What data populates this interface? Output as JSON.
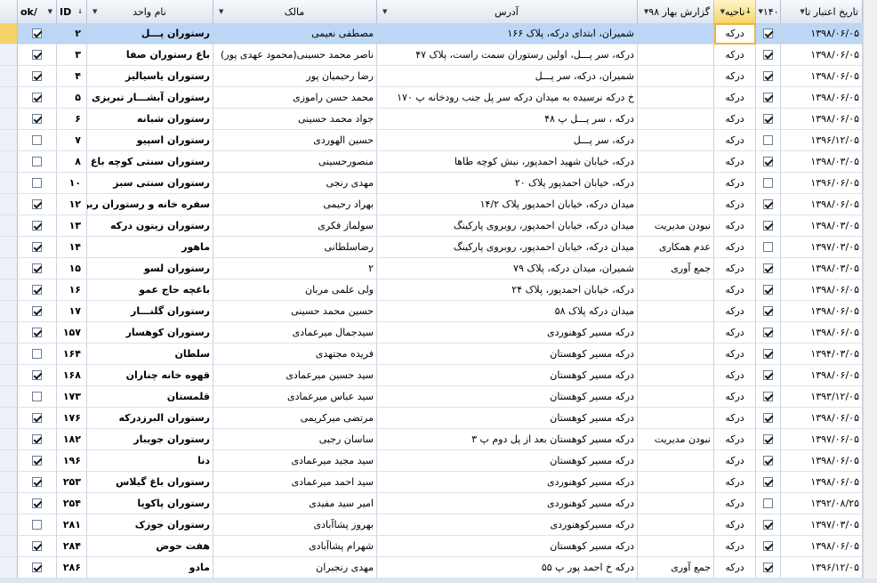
{
  "columns": {
    "date": "تاریخ اعتبار تا",
    "c140": "۱۴۰",
    "naheye": "ناحیه",
    "report": "گزارش بهار ۹۸",
    "address": "آدرس",
    "owner": "مالک",
    "unit": "نام واحد",
    "id": "ID",
    "ok": "ok/"
  },
  "rows": [
    {
      "date": "۱۳۹۸/۰۶/۰۵",
      "c140": true,
      "naheye": "درکه",
      "report": "",
      "address": "شمیران، ابتدای درکه، پلاک ۱۶۶",
      "owner": "مصطفی نعیمی",
      "unit": "رستوران پـــل",
      "id": "۲",
      "ok": true
    },
    {
      "date": "۱۳۹۸/۰۶/۰۵",
      "c140": true,
      "naheye": "درکه",
      "report": "",
      "address": "درکه، سر پـــل، اولین رستوران سمت راست، پلاک ۴۷",
      "owner": "ناصر محمد حسینی(محمود عهدی پور)",
      "unit": "باغ رستوران صفا",
      "id": "۳",
      "ok": true
    },
    {
      "date": "۱۳۹۸/۰۶/۰۵",
      "c140": true,
      "naheye": "درکه",
      "report": "",
      "address": "شمیران، درکه، سر پـــل",
      "owner": "رضا رحیمیان پور",
      "unit": "رستوران یاسیالیز",
      "id": "۴",
      "ok": true
    },
    {
      "date": "۱۳۹۸/۰۶/۰۵",
      "c140": true,
      "naheye": "درکه",
      "report": "",
      "address": "خ درکه نرسیده به میدان درکه سر پل جنب رودخانه پ ۱۷۰",
      "owner": "محمد حسن راموزی",
      "unit": "رستوران آبشـــار تبریزی",
      "id": "۵",
      "ok": true
    },
    {
      "date": "۱۳۹۸/۰۶/۰۵",
      "c140": true,
      "naheye": "درکه",
      "report": "",
      "address": "درکه ، سر پـــل پ ۴۸",
      "owner": "جواد محمد حسینی",
      "unit": "رستوران شبانه",
      "id": "۶",
      "ok": true
    },
    {
      "date": "۱۳۹۶/۱۲/۰۵",
      "c140": false,
      "naheye": "درکه",
      "report": "",
      "address": "درکه، سر پـــل",
      "owner": "حسین الهوردی",
      "unit": "رستوران اسپیو",
      "id": "۷",
      "ok": false
    },
    {
      "date": "۱۳۹۸/۰۳/۰۵",
      "c140": true,
      "naheye": "درکه",
      "report": "",
      "address": "درکه، خیابان شهید احمدپور، نبش کوچه طاها",
      "owner": "منصورحسینی",
      "unit": "رستوران سنتی کوچه باغ",
      "id": "۸",
      "ok": false
    },
    {
      "date": "۱۳۹۶/۰۶/۰۵",
      "c140": false,
      "naheye": "درکه",
      "report": "",
      "address": "درکه، خیابان احمدپور پلاک ۲۰",
      "owner": "مهدی رنجی",
      "unit": "رستوران سنتی سبز",
      "id": "۱۰",
      "ok": false
    },
    {
      "date": "۱۳۹۸/۰۶/۰۵",
      "c140": true,
      "naheye": "درکه",
      "report": "",
      "address": "میدان درکه، خیابان احمدپور پلاک ۱۴/۲",
      "owner": "بهراد رحیمی",
      "unit": "سفره خانه و رستوران ربوی ولنا",
      "id": "۱۲",
      "ok": true
    },
    {
      "date": "۱۳۹۸/۰۳/۰۵",
      "c140": true,
      "naheye": "درکه",
      "report": "نبودن مدیریت",
      "address": "میدان درکه، خیابان احمدپور، روبروی پارکینگ",
      "owner": "سولماز فکری",
      "unit": "رستوران زیتون درکه",
      "id": "۱۳",
      "ok": true
    },
    {
      "date": "۱۳۹۷/۰۳/۰۵",
      "c140": false,
      "naheye": "درکه",
      "report": "عدم همکاری",
      "address": "میدان درکه، خیابان احمدپور، روبروی پارکینگ",
      "owner": "رضاسلطانی",
      "unit": "ماهور",
      "id": "۱۴",
      "ok": true
    },
    {
      "date": "۱۳۹۸/۰۳/۰۵",
      "c140": true,
      "naheye": "درکه",
      "report": "جمع آوری",
      "address": "شمیران، میدان درکه، پلاک ۷۹",
      "owner": "۲",
      "unit": "رستوران لسو",
      "id": "۱۵",
      "ok": true
    },
    {
      "date": "۱۳۹۸/۰۶/۰۵",
      "c140": true,
      "naheye": "درکه",
      "report": "",
      "address": "درکه، خیابان احمدپور، پلاک ۲۴",
      "owner": "ولی علمی مربان",
      "unit": "باغچه حاج عمو",
      "id": "۱۶",
      "ok": true
    },
    {
      "date": "۱۳۹۸/۰۶/۰۵",
      "c140": true,
      "naheye": "درکه",
      "report": "",
      "address": "میدان درکه پلاک ۵۸",
      "owner": "حسین محمد حسینی",
      "unit": "رستوران گلنـــار",
      "id": "۱۷",
      "ok": true
    },
    {
      "date": "۱۳۹۸/۰۶/۰۵",
      "c140": true,
      "naheye": "درکه",
      "report": "",
      "address": "درکه مسیر کوهنوردی",
      "owner": "سیدجمال میرعمادی",
      "unit": "رستوران کوهسار",
      "id": "۱۵۷",
      "ok": true
    },
    {
      "date": "۱۳۹۴/۰۳/۰۵",
      "c140": true,
      "naheye": "درکه",
      "report": "",
      "address": "درکه مسیر کوهستان",
      "owner": "فریده مجتهدی",
      "unit": "سلطان",
      "id": "۱۶۴",
      "ok": false
    },
    {
      "date": "۱۳۹۸/۰۶/۰۵",
      "c140": true,
      "naheye": "درکه",
      "report": "",
      "address": "درکه مسیر کوهستان",
      "owner": "سید حسین میرعمادی",
      "unit": "قهوه خانه چناران",
      "id": "۱۶۸",
      "ok": true
    },
    {
      "date": "۱۳۹۳/۱۲/۰۵",
      "c140": true,
      "naheye": "درکه",
      "report": "",
      "address": "درکه مسیر کوهستان",
      "owner": "سید عباس میرعمادی",
      "unit": "قلمستان",
      "id": "۱۷۳",
      "ok": false
    },
    {
      "date": "۱۳۹۸/۰۶/۰۵",
      "c140": true,
      "naheye": "درکه",
      "report": "",
      "address": "درکه مسیر کوهستان",
      "owner": "مرتضی میرکریمی",
      "unit": "رستوران البرزدرکه",
      "id": "۱۷۶",
      "ok": true
    },
    {
      "date": "۱۳۹۷/۰۶/۰۵",
      "c140": true,
      "naheye": "درکه",
      "report": "نبودن مدیریت",
      "address": "درکه مسیر کوهستان بعد از پل دوم پ ۳",
      "owner": "ساسان رجبی",
      "unit": "رستوران جویبار",
      "id": "۱۸۲",
      "ok": true
    },
    {
      "date": "۱۳۹۸/۰۶/۰۵",
      "c140": true,
      "naheye": "درکه",
      "report": "",
      "address": "درکه مسیر کوهستان",
      "owner": "سید مجید میرعمادی",
      "unit": "دنا",
      "id": "۱۹۶",
      "ok": true
    },
    {
      "date": "۱۳۹۸/۰۶/۰۵",
      "c140": true,
      "naheye": "درکه",
      "report": "",
      "address": "درکه مسیر کوهنوردی",
      "owner": "سید احمد میرعمادی",
      "unit": "رستوران باغ گیلاس",
      "id": "۲۵۳",
      "ok": true
    },
    {
      "date": "۱۳۹۲/۰۸/۲۵",
      "c140": false,
      "naheye": "درکه",
      "report": "",
      "address": "درکه مسیر کوهنوردی",
      "owner": "امیر سید مفیدی",
      "unit": "رستوران پاکوپا",
      "id": "۲۵۴",
      "ok": true
    },
    {
      "date": "۱۳۹۷/۰۳/۰۵",
      "c140": true,
      "naheye": "درکه",
      "report": "",
      "address": "درکه مسیرکوهنوردی",
      "owner": "بهروز پشاآبادی",
      "unit": "رستوران جوزک",
      "id": "۲۸۱",
      "ok": false
    },
    {
      "date": "۱۳۹۸/۰۶/۰۵",
      "c140": true,
      "naheye": "درکه",
      "report": "",
      "address": "درکه مسیر کوهستان",
      "owner": "شهرام پشاآبادی",
      "unit": "هفت حوض",
      "id": "۲۸۴",
      "ok": true
    },
    {
      "date": "۱۳۹۶/۱۲/۰۵",
      "c140": true,
      "naheye": "درکه",
      "report": "جمع آوری",
      "address": "درکه خ احمد پور پ ۵۵",
      "owner": "مهدی رنجبران",
      "unit": "مادو",
      "id": "۲۸۶",
      "ok": true
    }
  ]
}
